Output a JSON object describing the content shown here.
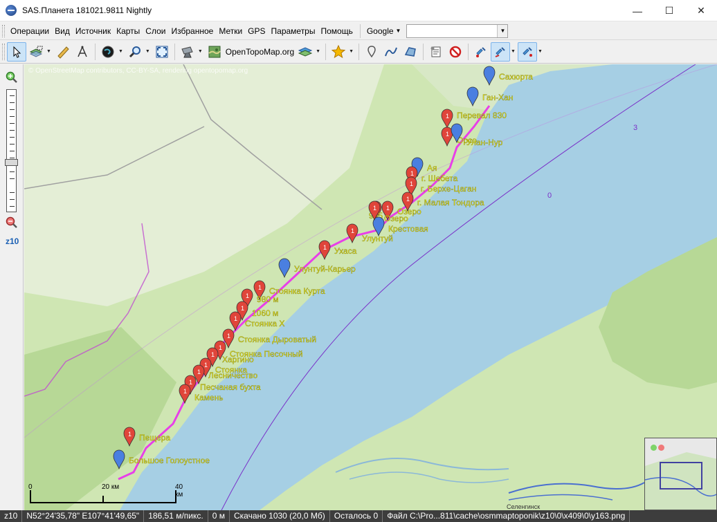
{
  "window": {
    "title": "SAS.Планета 181021.9811 Nightly",
    "minimize_glyph": "—",
    "maximize_glyph": "☐",
    "close_glyph": "✕"
  },
  "menu": {
    "items": [
      {
        "label": "Операции",
        "ul": "О"
      },
      {
        "label": "Вид",
        "ul": "В"
      },
      {
        "label": "Источник",
        "ul": "И"
      },
      {
        "label": "Карты",
        "ul": "К"
      },
      {
        "label": "Слои",
        "ul": ""
      },
      {
        "label": "Избранное",
        "ul": ""
      },
      {
        "label": "Метки",
        "ul": ""
      },
      {
        "label": "GPS",
        "ul": ""
      },
      {
        "label": "Параметры",
        "ul": ""
      },
      {
        "label": "Помощь",
        "ul": "П"
      }
    ],
    "search_engine": "Google",
    "search_value": ""
  },
  "toolbar": {
    "map_source": "OpenTopoMap.org"
  },
  "zoom": {
    "level_label": "z10"
  },
  "map": {
    "attribution": "© OpenStreetMap contributors, CC-BY-SA, rendering opentopomap.org",
    "grid_labels": [
      "3",
      "0"
    ],
    "scale": {
      "zero": "0",
      "mid": "20 км",
      "end": "40 км"
    },
    "town_label": "Селенгинск",
    "placemarks": [
      {
        "label": "Сахюрта",
        "color": "blue"
      },
      {
        "label": "Ган-Хан",
        "color": "blue"
      },
      {
        "label": "Перевал 830",
        "color": "red"
      },
      {
        "label": "Орсо",
        "color": "red"
      },
      {
        "label": "Улан-Нур",
        "color": "blue"
      },
      {
        "label": "Ая",
        "color": "blue"
      },
      {
        "label": "г. Шебета",
        "color": "red"
      },
      {
        "label": "г. Берхе-Цаган",
        "color": "red"
      },
      {
        "label": "г. Малая Тондора",
        "color": "red"
      },
      {
        "label": "Озеро",
        "color": "red"
      },
      {
        "label": "905",
        "color": "red"
      },
      {
        "label": "Крестовая",
        "color": "blue"
      },
      {
        "label": "Озеро",
        "color": "red"
      },
      {
        "label": "Улунтуй",
        "color": "red"
      },
      {
        "label": "Ухаса",
        "color": "red"
      },
      {
        "label": "Улунтуй-Карьер",
        "color": "blue"
      },
      {
        "label": "Стоянка Курта",
        "color": "red"
      },
      {
        "label": "980 м",
        "color": "red"
      },
      {
        "label": "1060 м",
        "color": "red"
      },
      {
        "label": "Стоянка Х",
        "color": "red"
      },
      {
        "label": "Стоянка Дыроватый",
        "color": "red"
      },
      {
        "label": "Стоянка Песочный",
        "color": "red"
      },
      {
        "label": "Харгино",
        "color": "red"
      },
      {
        "label": "Стоянка",
        "color": "red"
      },
      {
        "label": "Лесничество",
        "color": "red"
      },
      {
        "label": "Песчаная бухта",
        "color": "red"
      },
      {
        "label": "Камень",
        "color": "red"
      },
      {
        "label": "Пещера",
        "color": "red"
      },
      {
        "label": "Большое Голоустное",
        "color": "blue"
      }
    ]
  },
  "status": {
    "zoom": "z10",
    "coords": "N52°24'35,78\" E107°41'49,65\"",
    "resolution": "186,51 м/пикс.",
    "altitude": "0 м",
    "downloaded": "Скачано 1030 (20,0 Мб)",
    "remaining": "Осталось 0",
    "file": "Файл C:\\Pro...811\\cache\\osmmaptoponik\\z10\\0\\x409\\0\\y163.png"
  },
  "colors": {
    "lake": "#a6cfe4",
    "land": "#cfe6b3",
    "route": "#e83fe8",
    "pin_red": "#e0453a",
    "pin_blue": "#4a7fe0",
    "label": "#f7f21c"
  }
}
